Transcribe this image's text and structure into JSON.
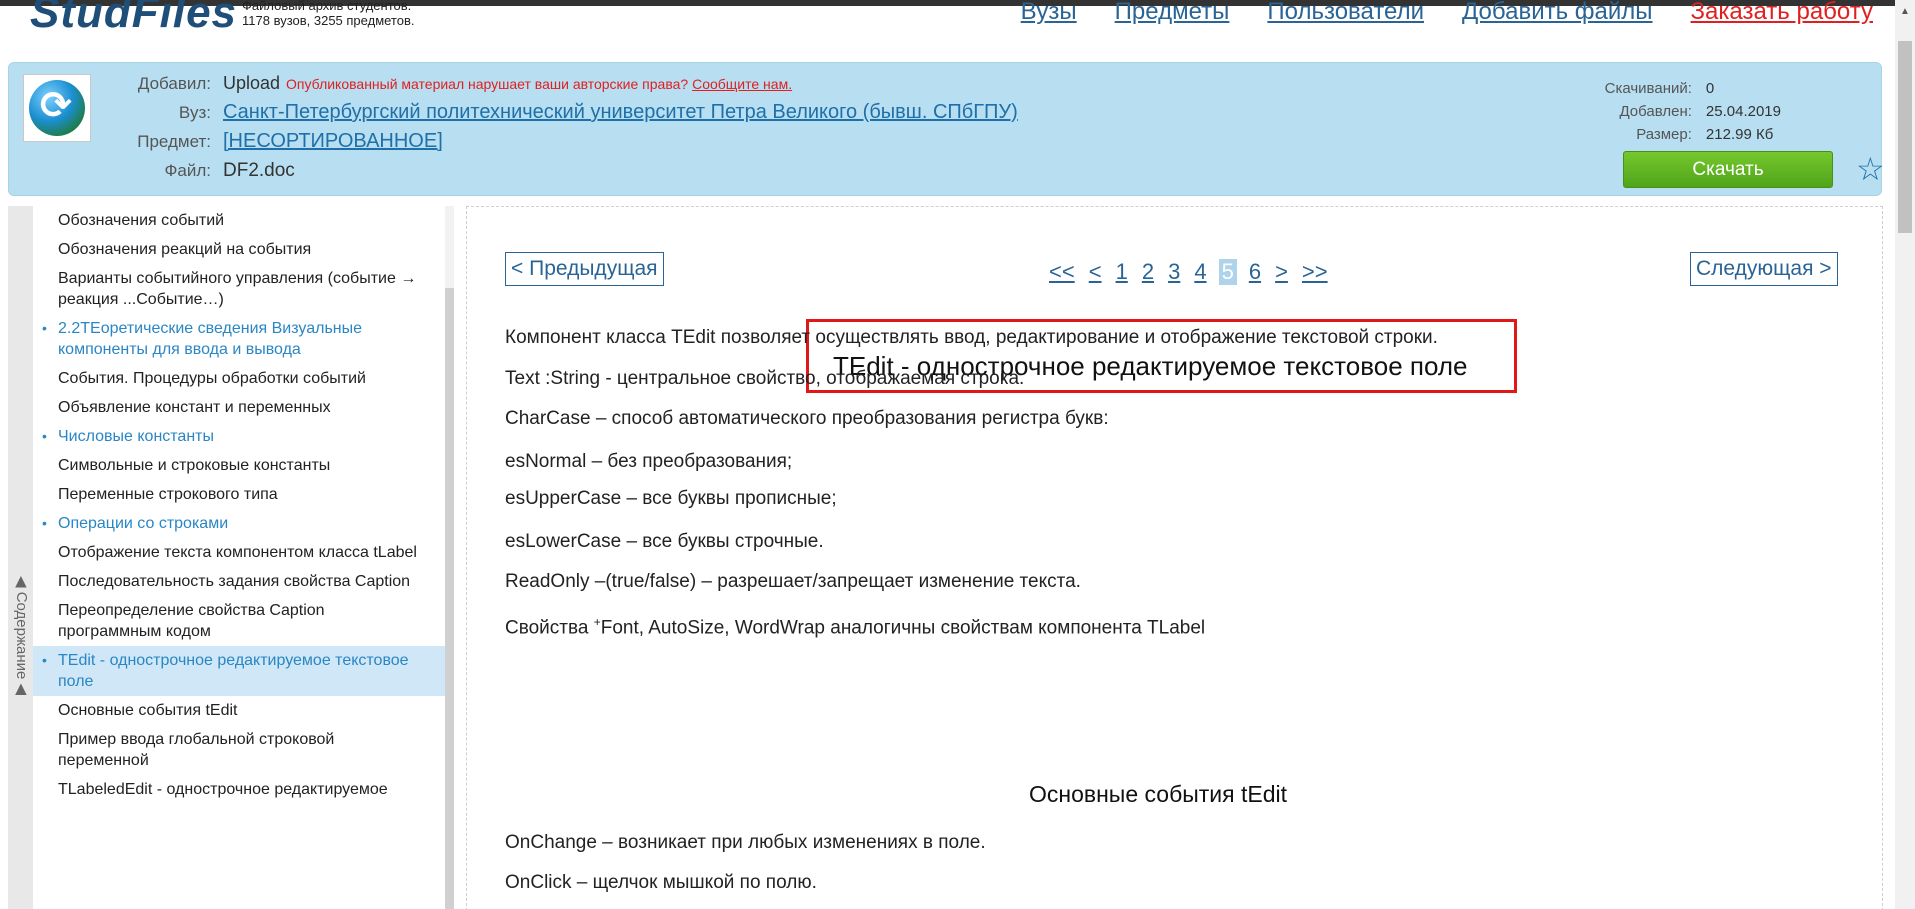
{
  "header": {
    "logo": "StudFiles",
    "logo_sub_line1": "Файловый архив студентов.",
    "logo_sub_line2": "1178 вузов, 3255 предметов.",
    "nav": [
      "Вузы",
      "Предметы",
      "Пользователи",
      "Добавить файлы",
      "Заказать работу"
    ]
  },
  "file_info": {
    "added_label": "Добавил:",
    "added_value": "Upload",
    "copyright_warning": "Опубликованный материал нарушает ваши авторские права?",
    "report_link": "Сообщите нам.",
    "university_label": "Вуз:",
    "university": "Санкт-Петербургский политехнический университет Петра Великого (бывш. СПбГПУ)",
    "subject_label": "Предмет:",
    "subject": "[НЕСОРТИРОВАННОЕ]",
    "file_label": "Файл:",
    "file_name": "DF2.doc",
    "downloads_label": "Скачиваний:",
    "downloads": "0",
    "date_label": "Добавлен:",
    "date": "25.04.2019",
    "size_label": "Размер:",
    "size": "212.99 Кб",
    "download_button": "Скачать",
    "favorite_icon": "star-icon"
  },
  "sidebar": {
    "vertical_label": "◀ Содержание ◀",
    "items": [
      {
        "label": "Обозначения событий",
        "level": 2
      },
      {
        "label": "Обозначения реакций на события",
        "level": 2
      },
      {
        "label": "Варианты событийного управления (событие → реакция ...Событие…)",
        "level": 2
      },
      {
        "label": "2.2ТЕоретические сведения Визуальные компоненты для ввода и вывода",
        "level": 1
      },
      {
        "label": "События. Процедуры обработки событий",
        "level": 2
      },
      {
        "label": "Объявление констант и переменных",
        "level": 2
      },
      {
        "label": "Числовые константы",
        "level": 1
      },
      {
        "label": "Символьные и строковые константы",
        "level": 2
      },
      {
        "label": "Переменные строкового типа",
        "level": 2
      },
      {
        "label": "Операции со строками",
        "level": 1
      },
      {
        "label": "Отображение текста компонентом класса tLabel",
        "level": 2
      },
      {
        "label": "Последовательность задания свойства Caption",
        "level": 2
      },
      {
        "label": "Переопределение свойства Caption программным кодом",
        "level": 2
      },
      {
        "label": "TEdit - однострочное редактируемое текстовое поле",
        "level": 1,
        "active": true
      },
      {
        "label": "Основные события tEdit",
        "level": 2
      },
      {
        "label": "Пример ввода глобальной строковой переменной",
        "level": 2
      },
      {
        "label": "TLabeledEdit - однострочное редактируемое",
        "level": 2
      }
    ]
  },
  "pagination": {
    "prev": "< Предыдущая",
    "next": "Следующая >",
    "first": "<<",
    "back": "<",
    "pages": [
      "1",
      "2",
      "3",
      "4",
      "5",
      "6"
    ],
    "current": "5",
    "forward": ">",
    "last": ">>"
  },
  "document": {
    "title": "TEdit - однострочное редактируемое текстовое поле",
    "paragraphs": [
      "Компонент класса TEdit позволяет осуществлять ввод, редактирование и отображение текстовой строки.",
      "Text :String - центральное свойство, отображаемая строка.",
      "CharCase – способ автоматического преобразования регистра букв:",
      "esNormal – без преобразования;",
      "esUpperCase – все буквы прописные;",
      "esLowerCase – все буквы строчные.",
      "ReadOnly –(true/false) – разрешает/запрещает изменение текста."
    ],
    "props_prefix": "Свойства ",
    "props_sup": "+",
    "props_rest": "Font, AutoSize, WordWrap аналогичны свойствам компонента TLabel",
    "subtitle": "Основные события tEdit",
    "events": [
      "OnChange – возникает при любых изменениях в поле.",
      "OnClick – щелчок мышкой по полю."
    ]
  }
}
